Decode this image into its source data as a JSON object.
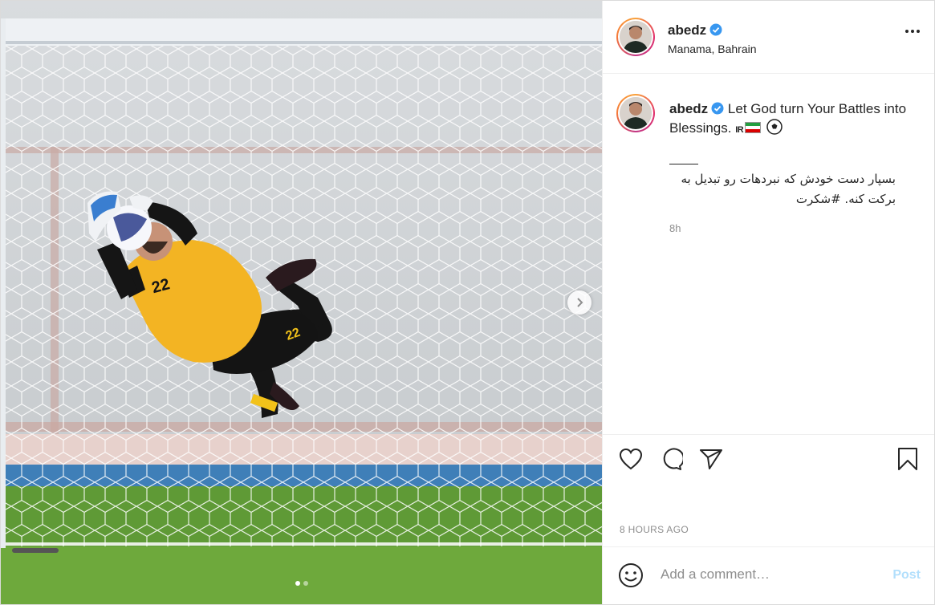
{
  "post": {
    "username": "abedz",
    "location": "Manama, Bahrain",
    "caption_text": "Let God turn Your Battles into Blessings.",
    "caption_flag": "IR",
    "caption_separator": "____",
    "caption_persian": "بسپار دست خودش که نبردهات رو تبدیل به برکت کنه. #شکرت",
    "comment_time": "8h",
    "timestamp": "8 HOURS AGO",
    "carousel": {
      "total_slides": 2,
      "active_slide": 1
    }
  },
  "comment_box": {
    "placeholder": "Add a comment…",
    "post_label": "Post"
  },
  "icons": {
    "verified": "verified-badge-icon",
    "more": "more-options-icon",
    "like": "heart-icon",
    "comment": "comment-bubble-icon",
    "share": "paper-plane-icon",
    "save": "bookmark-icon",
    "emoji": "smiley-icon",
    "next": "chevron-right-icon"
  },
  "colors": {
    "verified": "#3897f0",
    "post_button": "#b2dffc",
    "secondary_text": "#8e8e8e"
  }
}
